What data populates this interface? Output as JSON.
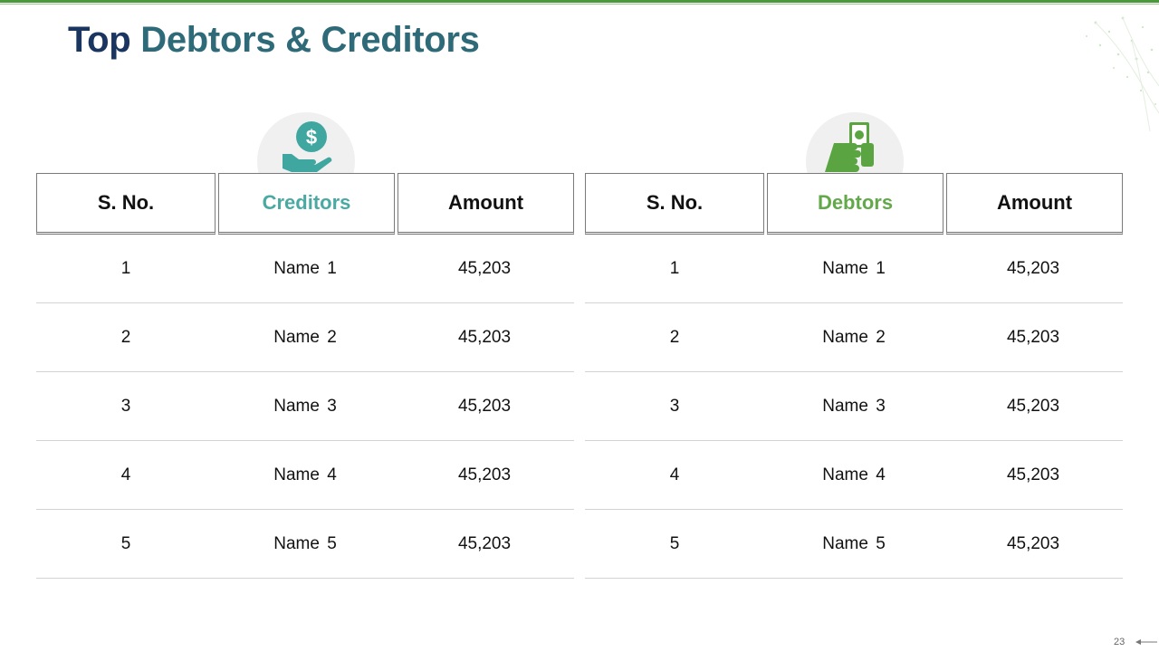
{
  "slide": {
    "title_part1": "Top",
    "title_part2": "Debtors & Creditors",
    "page_number": "23"
  },
  "colors": {
    "top_bar": "#4a9a3c",
    "title_dark": "#1a3560",
    "title_teal": "#2e6a78",
    "creditors_accent": "#4aa9a3",
    "debtors_accent": "#63a84a"
  },
  "creditors_table": {
    "icon": "dollar-hand-icon",
    "headers": [
      "S. No.",
      "Creditors",
      "Amount"
    ],
    "rows": [
      {
        "sno": "1",
        "name": "Name  1",
        "amount": "45,203"
      },
      {
        "sno": "2",
        "name": "Name  2",
        "amount": "45,203"
      },
      {
        "sno": "3",
        "name": "Name  3",
        "amount": "45,203"
      },
      {
        "sno": "4",
        "name": "Name  4",
        "amount": "45,203"
      },
      {
        "sno": "5",
        "name": "Name  5",
        "amount": "45,203"
      }
    ]
  },
  "debtors_table": {
    "icon": "cash-in-hand-icon",
    "headers": [
      "S. No.",
      "Debtors",
      "Amount"
    ],
    "rows": [
      {
        "sno": "1",
        "name": "Name  1",
        "amount": "45,203"
      },
      {
        "sno": "2",
        "name": "Name  2",
        "amount": "45,203"
      },
      {
        "sno": "3",
        "name": "Name  3",
        "amount": "45,203"
      },
      {
        "sno": "4",
        "name": "Name  4",
        "amount": "45,203"
      },
      {
        "sno": "5",
        "name": "Name  5",
        "amount": "45,203"
      }
    ]
  }
}
